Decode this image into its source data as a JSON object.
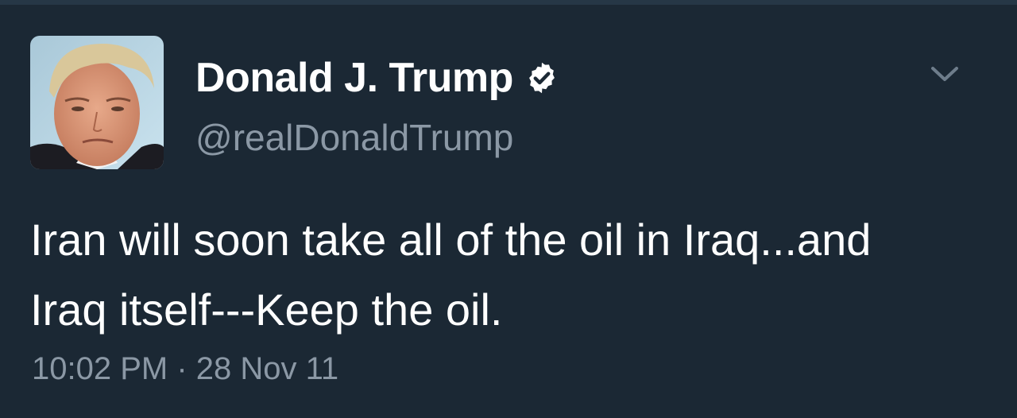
{
  "tweet": {
    "display_name": "Donald J. Trump",
    "handle": "@realDonaldTrump",
    "verified": true,
    "text_lines": [
      "Iran will soon take all of the oil in Iraq...and",
      "Iraq itself---Keep the oil."
    ],
    "timestamp": "10:02 PM · 28 Nov 11"
  },
  "icons": {
    "verified": "verified-badge-icon",
    "menu": "chevron-down-icon"
  },
  "colors": {
    "background": "#1b2834",
    "primary_text": "#ffffff",
    "secondary_text": "#8b98a5"
  }
}
